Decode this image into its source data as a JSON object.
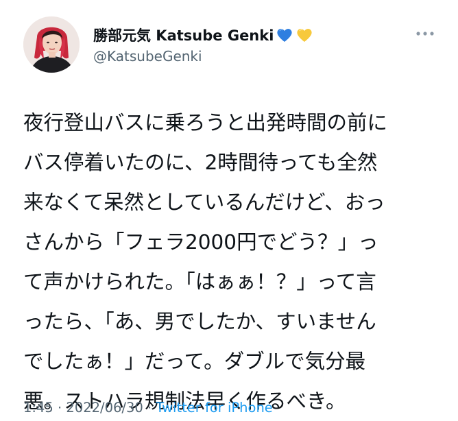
{
  "tweet": {
    "author": {
      "display_name": "勝部元気 Katsube Genki",
      "emojis": [
        "blue-heart-icon",
        "yellow-heart-icon"
      ],
      "handle": "@KatsubeGenki"
    },
    "more_icon": "more-options-icon",
    "text_lines": [
      "夜行登山バスに乗ろうと出発時間の前に",
      "バス停着いたのに、2時間待っても全然",
      "来なくて呆然としているんだけど、おっ",
      "さんから「フェラ2000円でどう？」っ",
      "て声かけられた。「はぁぁ！？」って言",
      "ったら、「あ、男でしたか、すいません",
      "でしたぁ！」だって。ダブルで気分最",
      "悪。ストハラ規制法早く作るべき。"
    ],
    "time": "1:45",
    "date": "2022/06/30",
    "separator": "·",
    "source": "Twitter for iPhone",
    "colors": {
      "text": "#0f1419",
      "secondary": "#536471",
      "link": "#1d9bf0",
      "blue_heart": "#2f7fe0",
      "yellow_heart": "#f7c93c"
    }
  }
}
